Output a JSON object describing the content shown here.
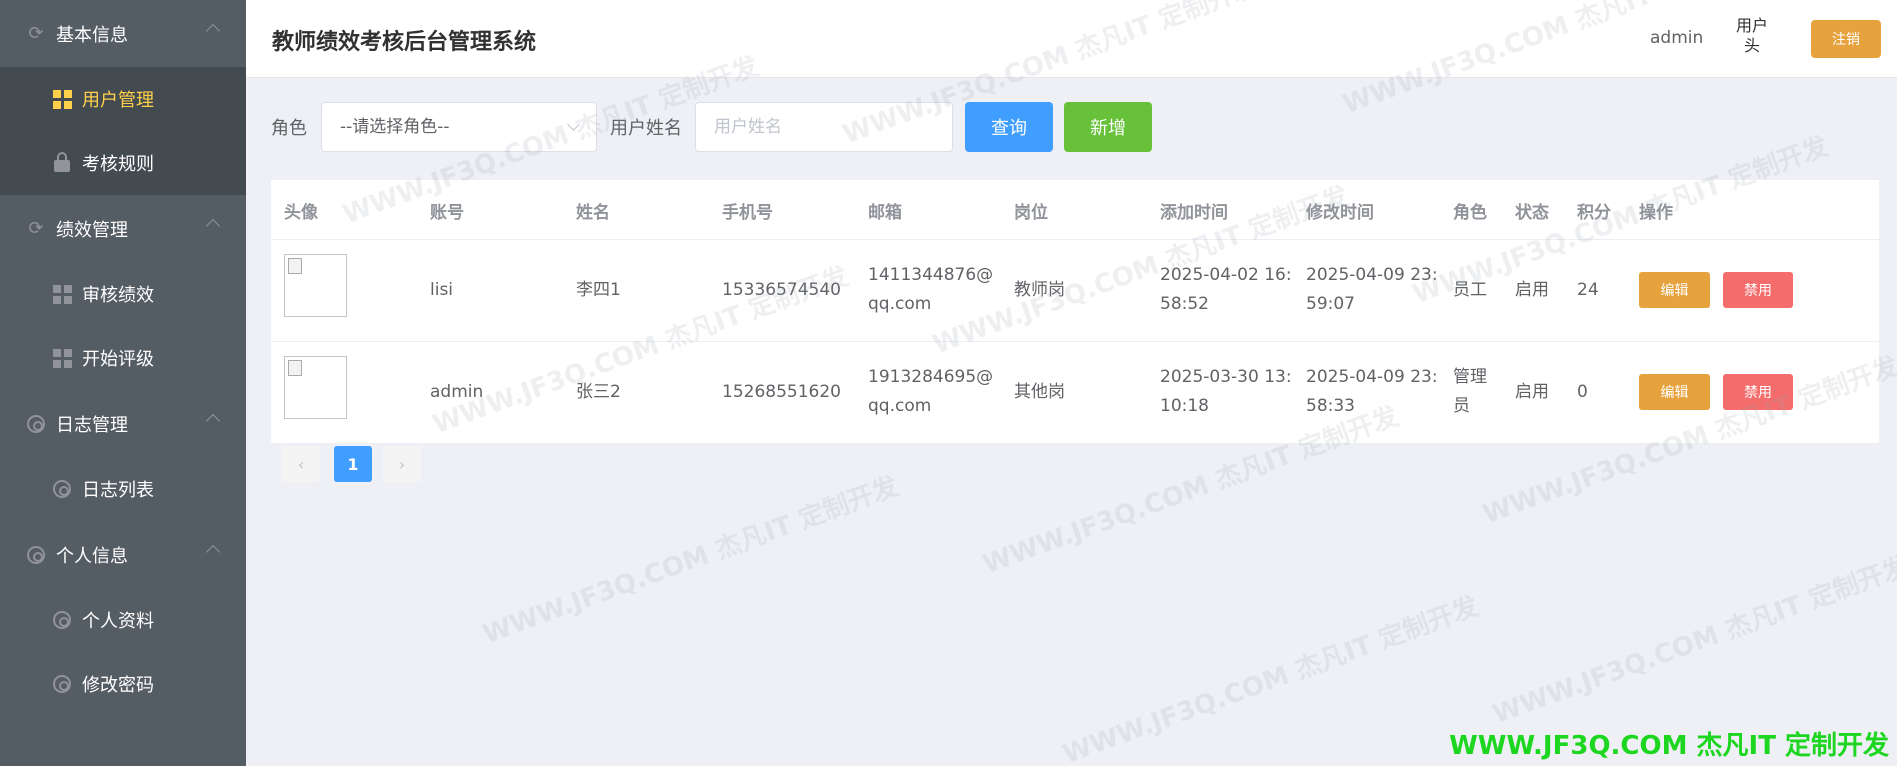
{
  "sidebar": {
    "groups": [
      {
        "title": "基本信息",
        "items": [
          {
            "label": "用户管理"
          },
          {
            "label": "考核规则"
          }
        ]
      },
      {
        "title": "绩效管理",
        "items": [
          {
            "label": "审核绩效"
          },
          {
            "label": "开始评级"
          }
        ]
      },
      {
        "title": "日志管理",
        "items": [
          {
            "label": "日志列表"
          }
        ]
      },
      {
        "title": "个人信息",
        "items": [
          {
            "label": "个人资料"
          },
          {
            "label": "修改密码"
          }
        ]
      }
    ],
    "active_color": "#ffd04b",
    "background": "#545c64"
  },
  "header": {
    "title": "教师绩效考核后台管理系统",
    "username": "admin",
    "avatar_alt": "用户头",
    "logout_label": "注销"
  },
  "filters": {
    "role_label": "角色",
    "role_selected": "--请选择角色--",
    "name_label": "用户姓名",
    "name_placeholder": "用户姓名",
    "query_label": "查询",
    "add_label": "新增"
  },
  "table": {
    "headers": [
      "头像",
      "账号",
      "姓名",
      "手机号",
      "邮箱",
      "岗位",
      "添加时间",
      "修改时间",
      "角色",
      "状态",
      "积分",
      "操作"
    ],
    "rows": [
      {
        "account": "lisi",
        "name": "李四1",
        "phone": "15336574540",
        "email_l1": "1411344876@",
        "email_l2": "qq.com",
        "post": "教师岗",
        "added_l1": "2025-04-02 16:",
        "added_l2": "58:52",
        "modified_l1": "2025-04-09 23:",
        "modified_l2": "59:07",
        "role_l1": "员工",
        "role_l2": "",
        "status": "启用",
        "points": "24",
        "edit_label": "编辑",
        "disable_label": "禁用"
      },
      {
        "account": "admin",
        "name": "张三2",
        "phone": "15268551620",
        "email_l1": "1913284695@",
        "email_l2": "qq.com",
        "post": "其他岗",
        "added_l1": "2025-03-30 13:",
        "added_l2": "10:18",
        "modified_l1": "2025-04-09 23:",
        "modified_l2": "58:33",
        "role_l1": "管理",
        "role_l2": "员",
        "status": "启用",
        "points": "0",
        "edit_label": "编辑",
        "disable_label": "禁用"
      }
    ]
  },
  "pagination": {
    "prev": "‹",
    "current": "1",
    "next": "›"
  },
  "watermark": {
    "text": "WWW.JF3Q.COM 杰凡IT 定制开发",
    "corner_color": "#1dd620"
  }
}
